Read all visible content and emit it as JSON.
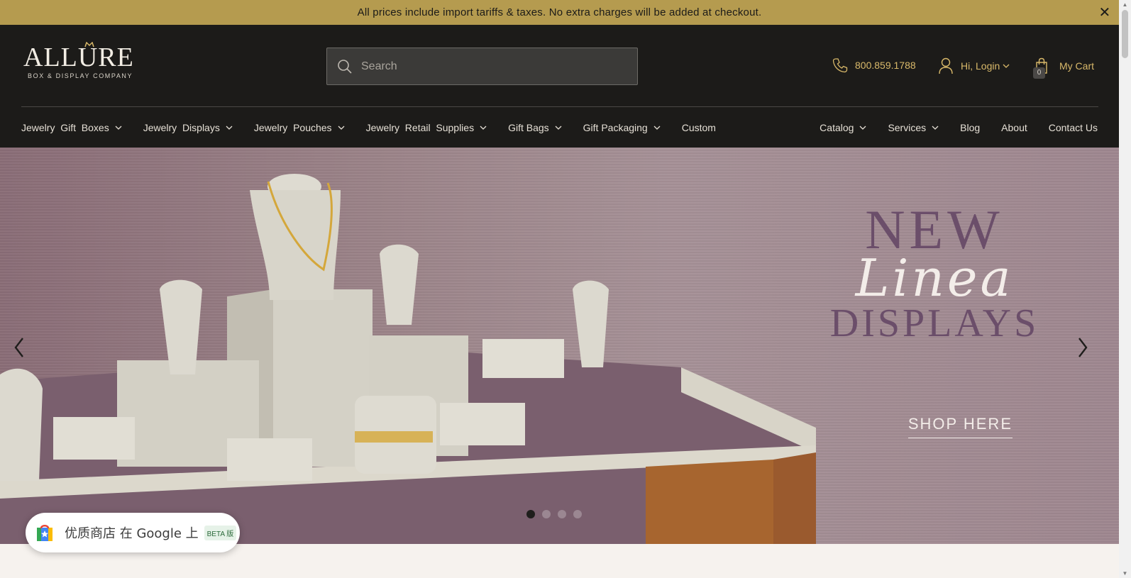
{
  "promo": {
    "text": "All prices include import tariffs & taxes. No extra charges will be added at checkout."
  },
  "logo": {
    "word": "ALLURE",
    "sub": "BOX & DISPLAY COMPANY"
  },
  "search": {
    "placeholder": "Search"
  },
  "utility": {
    "phone": "800.859.1788",
    "login": "Hi, Login",
    "cart_label": "My Cart",
    "cart_count": "0"
  },
  "nav_left": [
    {
      "label": "Jewelry  Gift  Boxes",
      "dropdown": true
    },
    {
      "label": "Jewelry  Displays",
      "dropdown": true
    },
    {
      "label": "Jewelry  Pouches",
      "dropdown": true
    },
    {
      "label": "Jewelry  Retail  Supplies",
      "dropdown": true
    },
    {
      "label": "Gift Bags",
      "dropdown": true
    },
    {
      "label": "Gift Packaging",
      "dropdown": true
    },
    {
      "label": "Custom",
      "dropdown": false
    }
  ],
  "nav_right": [
    {
      "label": "Catalog",
      "dropdown": true
    },
    {
      "label": "Services",
      "dropdown": true
    },
    {
      "label": "Blog",
      "dropdown": false
    },
    {
      "label": "About",
      "dropdown": false
    },
    {
      "label": "Contact Us",
      "dropdown": false
    }
  ],
  "hero": {
    "line1": "NEW",
    "line2": "Linea",
    "line3": "DISPLAYS",
    "cta": "SHOP HERE",
    "slides": 4,
    "active_slide": 1
  },
  "google_badge": {
    "text": "优质商店 在 Google 上",
    "beta": "BETA 版"
  },
  "colors": {
    "promo_bg": "#b59b4f",
    "header_bg": "#1c1b19",
    "accent_gold": "#d9b96a",
    "hero_purple": "#6b4e6a"
  }
}
